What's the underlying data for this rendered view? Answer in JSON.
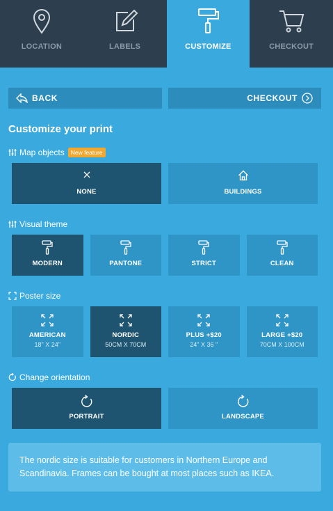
{
  "tabs": [
    {
      "label": "LOCATION",
      "icon": "location-pin-icon",
      "active": false
    },
    {
      "label": "LABELS",
      "icon": "edit-icon",
      "active": false
    },
    {
      "label": "CUSTOMIZE",
      "icon": "paint-roller-icon",
      "active": true
    },
    {
      "label": "CHECKOUT",
      "icon": "shopping-cart-icon",
      "active": false
    }
  ],
  "nav": {
    "back_label": "BACK",
    "checkout_label": "CHECKOUT"
  },
  "title": "Customize your print",
  "map_objects": {
    "label": "Map objects",
    "badge": "New feature",
    "options": [
      {
        "label": "NONE",
        "icon": "close-icon",
        "selected": true
      },
      {
        "label": "BUILDINGS",
        "icon": "house-icon",
        "selected": false
      }
    ]
  },
  "visual_theme": {
    "label": "Visual theme",
    "options": [
      {
        "label": "MODERN",
        "icon": "paint-roller-icon",
        "selected": true
      },
      {
        "label": "PANTONE",
        "icon": "paint-roller-icon",
        "selected": false
      },
      {
        "label": "STRICT",
        "icon": "paint-roller-icon",
        "selected": false
      },
      {
        "label": "CLEAN",
        "icon": "paint-roller-icon",
        "selected": false
      }
    ]
  },
  "poster_size": {
    "label": "Poster size",
    "options": [
      {
        "label": "AMERICAN",
        "sub": "18\" X 24\"",
        "icon": "expand-icon",
        "selected": false
      },
      {
        "label": "NORDIC",
        "sub": "50CM X 70CM",
        "icon": "expand-icon",
        "selected": true
      },
      {
        "label": "PLUS +$20",
        "sub": "24\" X 36 \"",
        "icon": "expand-icon",
        "selected": false
      },
      {
        "label": "LARGE +$20",
        "sub": "70CM X 100CM",
        "icon": "expand-icon",
        "selected": false
      }
    ]
  },
  "orientation": {
    "label": "Change orientation",
    "options": [
      {
        "label": "PORTRAIT",
        "icon": "rotate-icon",
        "selected": true
      },
      {
        "label": "LANDSCAPE",
        "icon": "rotate-icon",
        "selected": false
      }
    ]
  },
  "info_text": "The nordic size is suitable for customers in Northern Europe and Scandinavia. Frames can be bought at most places such as IKEA.",
  "colors": {
    "background": "#3aa9dd",
    "tab_bar": "#2d3e4e",
    "option": "#2f95c6",
    "option_selected": "#1f5470",
    "badge": "#f0a830",
    "info_box": "#5ebde8"
  }
}
